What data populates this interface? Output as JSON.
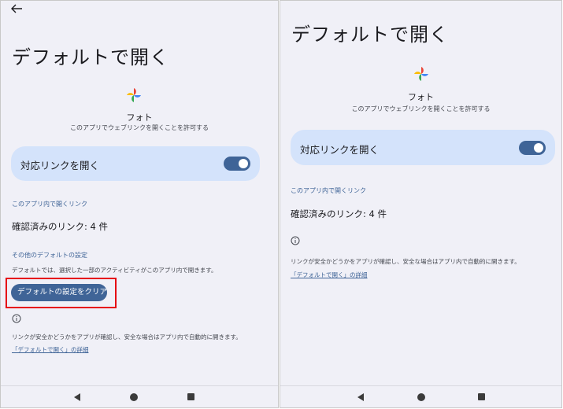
{
  "left": {
    "title": "デフォルトで開く",
    "app": {
      "name": "フォト",
      "description": "このアプリでウェブリンクを開くことを許可する",
      "icon": "google-photos-icon"
    },
    "open_links": {
      "label": "対応リンクを開く",
      "enabled": true
    },
    "in_app_section": "このアプリ内で開くリンク",
    "verified_links": "確認済みのリンク: 4 件",
    "other_defaults_section": "その他のデフォルトの設定",
    "other_defaults_desc": "デフォルトでは、選択した一部のアクティビティがこのアプリ内で開きます。",
    "clear_button": "デフォルトの設定をクリア",
    "info_text": "リンクが安全かどうかをアプリが確認し、安全な場合はアプリ内で自動的に開きます。",
    "info_link": "「デフォルトで開く」の詳細"
  },
  "right": {
    "title": "デフォルトで開く",
    "app": {
      "name": "フォト",
      "description": "このアプリでウェブリンクを開くことを許可する",
      "icon": "google-photos-icon"
    },
    "open_links": {
      "label": "対応リンクを開く",
      "enabled": true
    },
    "in_app_section": "このアプリ内で開くリンク",
    "verified_links": "確認済みのリンク: 4 件",
    "info_text": "リンクが安全かどうかをアプリが確認し、安全な場合はアプリ内で自動的に開きます。",
    "info_link": "「デフォルトで開く」の詳細"
  },
  "colors": {
    "accent": "#3f6497",
    "card": "#d4e3fb",
    "background": "#f0f0f7",
    "highlight": "#e60012"
  }
}
